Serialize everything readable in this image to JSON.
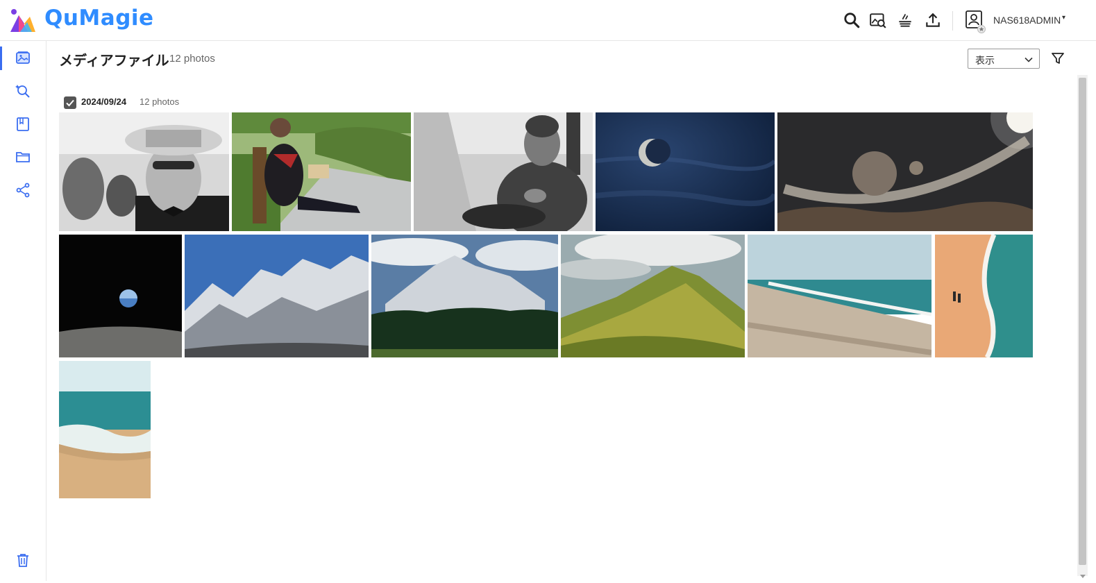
{
  "app": {
    "logo_text": "QuMagie",
    "brand_color": "#2f8cff"
  },
  "header": {
    "icons": [
      "search-icon",
      "image-search-icon",
      "background-task-icon",
      "upload-icon"
    ],
    "user": {
      "name": "NAS618ADMIN",
      "caret": "▾"
    }
  },
  "sidebar": {
    "items": [
      {
        "name": "photos",
        "icon": "photo-album-icon",
        "active": true
      },
      {
        "name": "smart-search",
        "icon": "magic-search-icon",
        "active": false
      },
      {
        "name": "albums",
        "icon": "album-book-icon",
        "active": false
      },
      {
        "name": "folders",
        "icon": "folder-icon",
        "active": false
      },
      {
        "name": "shared",
        "icon": "share-icon",
        "active": false
      }
    ],
    "bottom_icon": "trash-icon"
  },
  "main": {
    "title": "メディアファイル",
    "count": "12 photos",
    "view_select": {
      "value": "表示"
    },
    "accent_color": "#3a6df0"
  },
  "group": {
    "checked": true,
    "date": "2024/09/24",
    "count": "12 photos",
    "photos": [
      {
        "subject": "old man with straw hat, black and white"
      },
      {
        "subject": "person reading on park bench"
      },
      {
        "subject": "elderly man sitting, black and white"
      },
      {
        "subject": "moon in night sky"
      },
      {
        "subject": "planets space art"
      },
      {
        "subject": "earth rising over moon"
      },
      {
        "subject": "snowy mountain range"
      },
      {
        "subject": "mountain and pine forest"
      },
      {
        "subject": "green mountain ridge"
      },
      {
        "subject": "sandy beach and sea"
      },
      {
        "subject": "aerial beach shoreline"
      },
      {
        "subject": "beach waves"
      }
    ]
  }
}
